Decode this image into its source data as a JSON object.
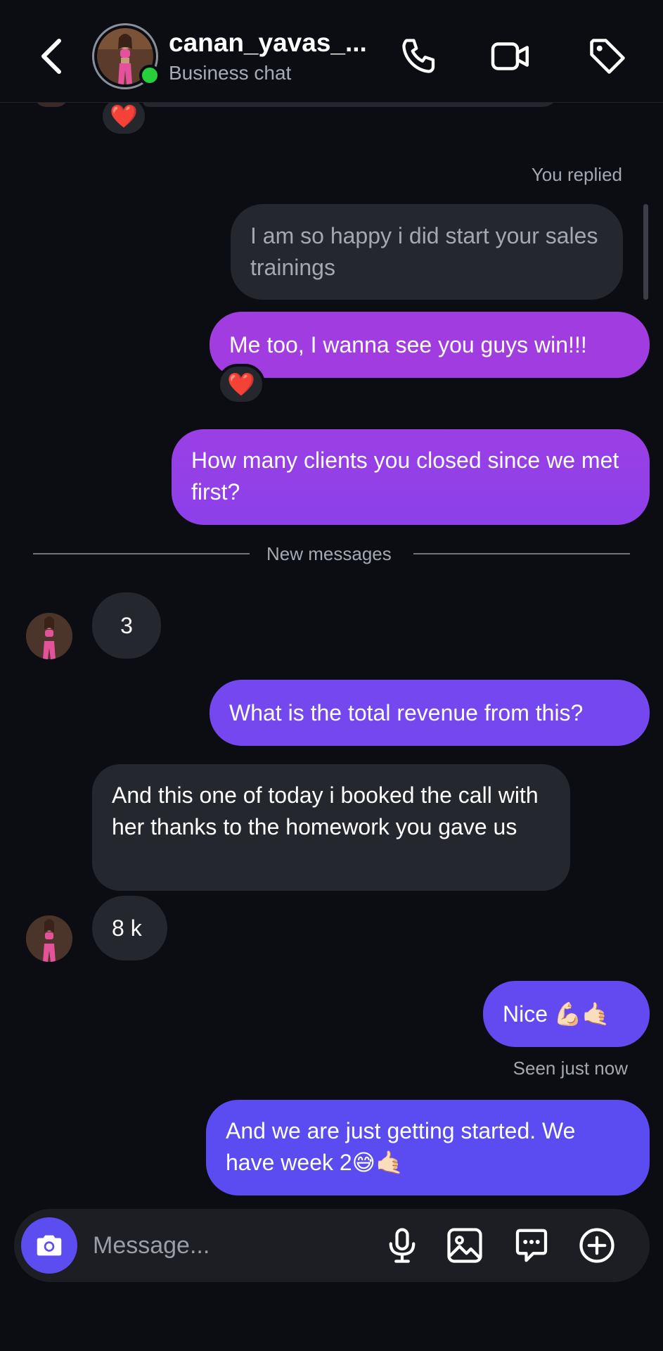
{
  "header": {
    "title": "canan_yavas_...",
    "subtitle": "Business chat",
    "icons": [
      "back-icon",
      "phone-icon",
      "video-icon",
      "tag-icon"
    ]
  },
  "messages": {
    "top_reaction": "❤️",
    "you_replied_label": "You replied",
    "quoted_text": "I am so happy i did start your sales trainings",
    "msg1": "Me too, I wanna see you guys win!!!",
    "msg1_reaction": "❤️",
    "msg2": "How many clients you closed since we met first?",
    "new_messages_label": "New messages",
    "msg3": "3",
    "msg4": "What is the total revenue from this?",
    "msg5": "And this one of today i booked the call with her thanks to the homework you gave us",
    "msg6": "8 k",
    "msg7": "Nice 💪🏻🤙🏻",
    "seen_label": "Seen just now",
    "msg8": "And we are just getting started. We have week 2😅🤙🏻"
  },
  "composer": {
    "placeholder": "Message...",
    "icons": [
      "camera-icon",
      "microphone-icon",
      "gallery-icon",
      "chat-options-icon",
      "plus-icon"
    ]
  },
  "colors": {
    "background": "#0b0d12",
    "incoming_bubble": "#25272e",
    "outgoing_gradient_top": "#a33ee0",
    "outgoing_gradient_bottom": "#5a4cf0",
    "accent": "#5b4df0",
    "online": "#25d03b"
  }
}
